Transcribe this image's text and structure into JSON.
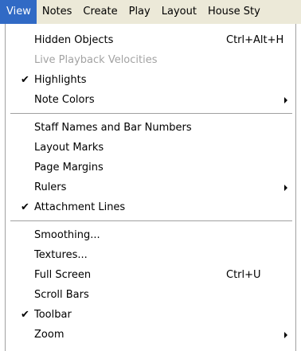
{
  "menubar": {
    "items": [
      {
        "label": "View",
        "active": true
      },
      {
        "label": "Notes"
      },
      {
        "label": "Create"
      },
      {
        "label": "Play"
      },
      {
        "label": "Layout"
      },
      {
        "label": "House Sty"
      }
    ]
  },
  "view_menu": {
    "groups": [
      [
        {
          "label": "Hidden Objects",
          "shortcut": "Ctrl+Alt+H"
        },
        {
          "label": "Live Playback Velocities",
          "disabled": true
        },
        {
          "label": "Highlights",
          "checked": true
        },
        {
          "label": "Note Colors",
          "submenu": true
        }
      ],
      [
        {
          "label": "Staff Names and Bar Numbers"
        },
        {
          "label": "Layout Marks"
        },
        {
          "label": "Page Margins"
        },
        {
          "label": "Rulers",
          "submenu": true
        },
        {
          "label": "Attachment Lines",
          "checked": true
        }
      ],
      [
        {
          "label": "Smoothing..."
        },
        {
          "label": "Textures..."
        },
        {
          "label": "Full Screen",
          "shortcut": "Ctrl+U"
        },
        {
          "label": "Scroll Bars"
        },
        {
          "label": "Toolbar",
          "checked": true
        },
        {
          "label": "Zoom",
          "submenu": true
        }
      ]
    ]
  },
  "colors": {
    "menubar_bg": "#ece9d8",
    "highlight": "#316ac5",
    "disabled_text": "#a3a3a3"
  },
  "icons": {
    "check": "checkmark-icon",
    "submenu": "chevron-right-icon"
  }
}
